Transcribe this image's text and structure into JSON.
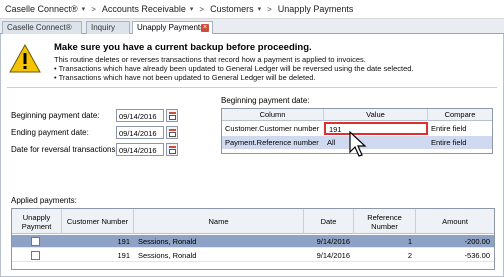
{
  "breadcrumb": {
    "items": [
      "Caselle Connect®",
      "Accounts Receivable",
      "Customers",
      "Unapply Payments"
    ]
  },
  "tabs": [
    {
      "label": "Caselle Connect®"
    },
    {
      "label": "Inquiry"
    },
    {
      "label": "Unapply Payments"
    }
  ],
  "warning": {
    "title": "Make sure you have a current backup before proceeding.",
    "lines": [
      "This routine deletes or reverses transactions that record how a payment is applied to invoices.",
      "• Transactions which have already been updated to General Ledger will be reversed using the date selected.",
      "• Transactions which have not been updated to General Ledger will be deleted."
    ]
  },
  "dates": {
    "beginning_label": "Beginning payment date:",
    "beginning_value": "09/14/2016",
    "ending_label": "Ending payment date:",
    "ending_value": "09/14/2016",
    "reversal_label": "Date for reversal transactions:",
    "reversal_value": "09/14/2016"
  },
  "criteria": {
    "group_label": "Beginning payment date:",
    "headers": [
      "Column",
      "Value",
      "Compare"
    ],
    "rows": [
      {
        "column": "Customer.Customer number",
        "value": "191",
        "compare": "Entire field"
      },
      {
        "column": "Payment.Reference number",
        "value": "All",
        "compare": "Entire field"
      }
    ]
  },
  "applied": {
    "label": "Applied payments:",
    "headers": [
      "Unapply Payment",
      "Customer Number",
      "Name",
      "Date",
      "Reference Number",
      "Amount"
    ],
    "rows": [
      {
        "customer": "191",
        "name": "Sessions, Ronald",
        "date": "9/14/2016",
        "reference": "1",
        "amount": "-200.00"
      },
      {
        "customer": "191",
        "name": "Sessions, Ronald",
        "date": "9/14/2016",
        "reference": "2",
        "amount": "-536.00"
      }
    ]
  },
  "colors": {
    "highlight_border": "#e0302c",
    "selected_row": "#8da2c4",
    "warning_yellow": "#f5c400"
  }
}
